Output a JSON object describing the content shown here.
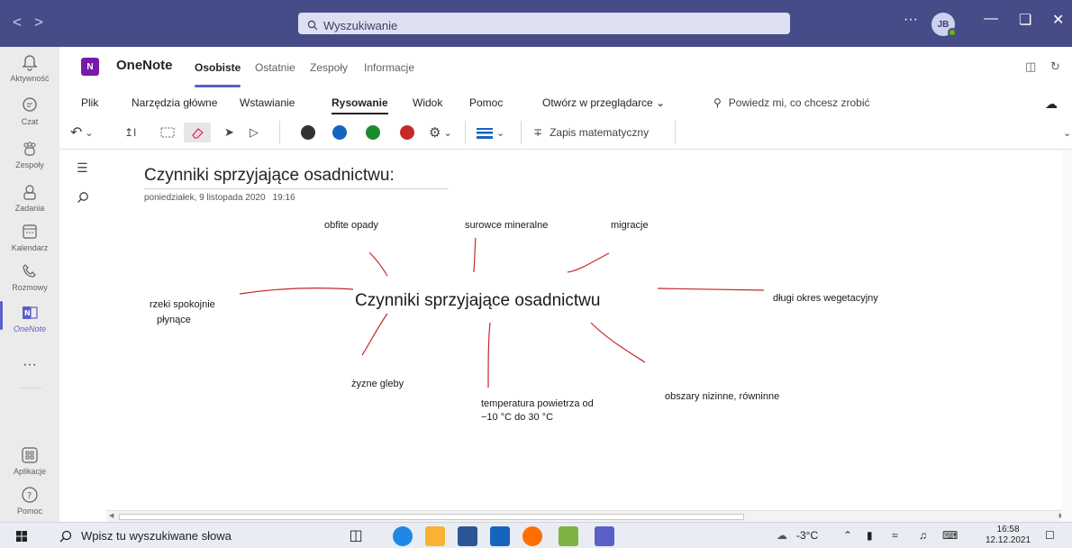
{
  "titlebar": {
    "search_placeholder": "Wyszukiwanie",
    "more": "···",
    "avatar_initials": "JB"
  },
  "rail": {
    "items": [
      {
        "label": "Aktywność",
        "icon": "bell-icon"
      },
      {
        "label": "Czat",
        "icon": "chat-icon"
      },
      {
        "label": "Zespoły",
        "icon": "teams-icon"
      },
      {
        "label": "Zadania",
        "icon": "tasks-icon"
      },
      {
        "label": "Kalendarz",
        "icon": "calendar-icon"
      },
      {
        "label": "Rozmowy",
        "icon": "phone-icon"
      },
      {
        "label": "OneNote",
        "icon": "onenote-icon",
        "active": true
      }
    ],
    "more": "···",
    "apps": "Aplikacje",
    "help": "Pomoc"
  },
  "header": {
    "app_name": "OneNote",
    "tabs": [
      "Osobiste",
      "Ostatnie",
      "Zespoły",
      "Informacje"
    ],
    "active_tab": "Osobiste"
  },
  "ribbon": {
    "menus": [
      "Plik",
      "Narzędzia główne",
      "Wstawianie",
      "Rysowanie",
      "Widok",
      "Pomoc"
    ],
    "active_menu": "Rysowanie",
    "open_browser": "Otwórz w przeglądarce",
    "tell_me": "Powiedz mi, co chcesz zrobić",
    "math": "Zapis matematyczny",
    "pen_colors": [
      "#333333",
      "#1565c0",
      "#1b8a2e",
      "#c62828"
    ]
  },
  "page": {
    "title": "Czynniki sprzyjające osadnictwu:",
    "date": "poniedziałek, 9 listopada 2020",
    "time": "19:16",
    "center": "Czynniki sprzyjające osadnictwu",
    "labels": {
      "opady": "obfite opady",
      "surowce": "surowce mineralne",
      "migracje": "migracje",
      "rzeki_1": "rzeki  spokojnie",
      "rzeki_2": "płynące",
      "wegetacja": "długi okres wegetacyjny",
      "gleby": "żyzne gleby",
      "temp_1": "temperatura powietrza od",
      "temp_2": "−10 °C do 30 °C",
      "nizinne": "obszary nizinne, równinne"
    }
  },
  "taskbar": {
    "search": "Wpisz tu wyszukiwane słowa",
    "temperature": "-3°C",
    "time": "16:58",
    "date": "12.12.2021"
  }
}
